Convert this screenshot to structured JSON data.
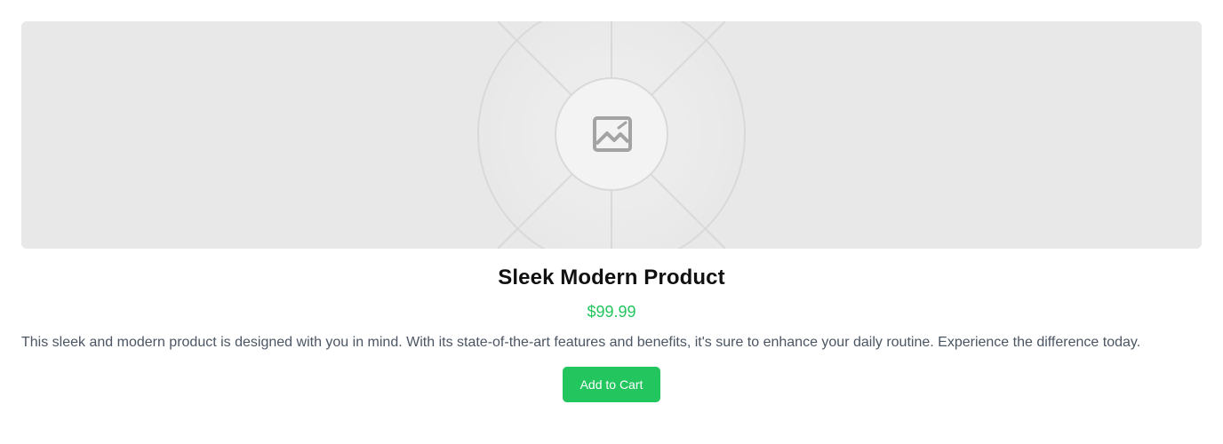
{
  "product": {
    "image_icon": "image-icon",
    "title": "Sleek Modern Product",
    "price": "$99.99",
    "description": "This sleek and modern product is designed with you in mind. With its state-of-the-art features and benefits, it's sure to enhance your daily routine. Experience the difference today.",
    "add_to_cart_label": "Add to Cart"
  },
  "colors": {
    "accent": "#22c55e",
    "placeholder_bg": "#e8e8e8",
    "title_text": "#111111",
    "body_text": "#4b5563"
  }
}
